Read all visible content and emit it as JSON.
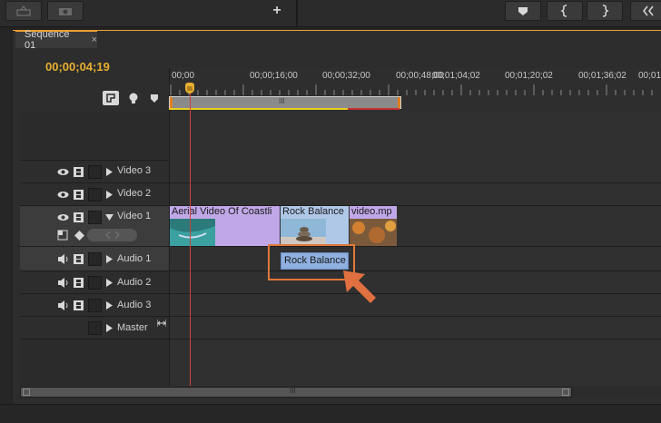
{
  "toolbar": {
    "add_label": "+",
    "marker_icon": "marker-icon",
    "in_icon": "mark-in-icon",
    "out_icon": "mark-out-icon"
  },
  "tab": {
    "title": "Sequence 01",
    "close": "×"
  },
  "timecode": "00;00;04;19",
  "ruler": {
    "ticks": [
      "00;00",
      "00;00;16;00",
      "00;00;32;00",
      "00;00;48;00",
      "00;01;04;02",
      "00;01;20;02",
      "00;01;36;02",
      "00;01"
    ],
    "work_area_handle": "III"
  },
  "tracks": {
    "video3": "Video 3",
    "video2": "Video 2",
    "video1": "Video 1",
    "audio1": "Audio 1",
    "audio2": "Audio 2",
    "audio3": "Audio 3",
    "master": "Master"
  },
  "clips": {
    "video_aerial": "Aerial Video Of Coastli",
    "video_rock": "Rock Balance",
    "video_mp": "video.mp",
    "audio_rock": "Rock Balance"
  },
  "scrollbar": {
    "handle": "III"
  },
  "colors": {
    "accent": "#e8b030",
    "video_clip": "#b7a0e0",
    "audio_clip": "#8fb0e0",
    "highlight": "#e07838"
  }
}
